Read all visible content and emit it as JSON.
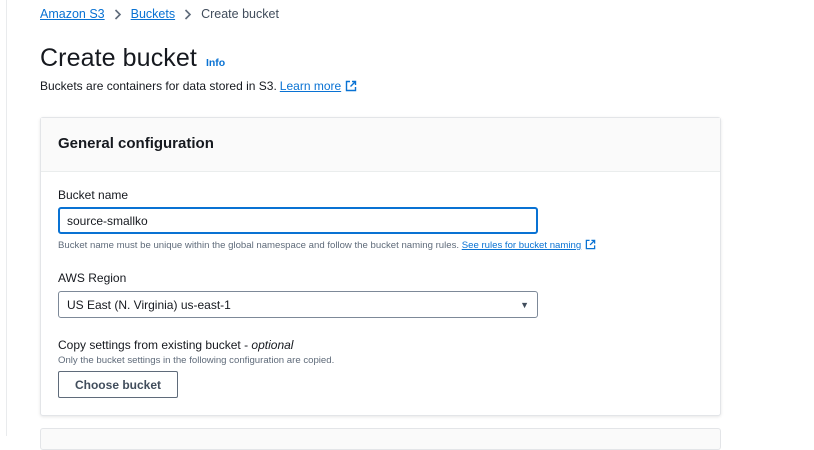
{
  "breadcrumb": {
    "items": [
      "Amazon S3",
      "Buckets"
    ],
    "current": "Create bucket"
  },
  "page": {
    "title": "Create bucket",
    "info_label": "Info",
    "description": "Buckets are containers for data stored in S3.",
    "learn_more": "Learn more"
  },
  "general_config": {
    "heading": "General configuration",
    "bucket_name": {
      "label": "Bucket name",
      "value": "source-smallko",
      "hint": "Bucket name must be unique within the global namespace and follow the bucket naming rules.",
      "rules_link": "See rules for bucket naming"
    },
    "region": {
      "label": "AWS Region",
      "selected": "US East (N. Virginia) us-east-1"
    },
    "copy_settings": {
      "label": "Copy settings from existing bucket -",
      "optional": "optional",
      "hint": "Only the bucket settings in the following configuration are copied.",
      "button": "Choose bucket"
    }
  },
  "icons": {
    "breadcrumb_separator": "chevron-right-icon",
    "external_link": "external-link-icon",
    "dropdown": "caret-down-icon"
  },
  "colors": {
    "link": "#0972d3",
    "input_focus_border": "#0972d3",
    "text": "#16191f",
    "secondary_text": "#5f6b7a"
  }
}
